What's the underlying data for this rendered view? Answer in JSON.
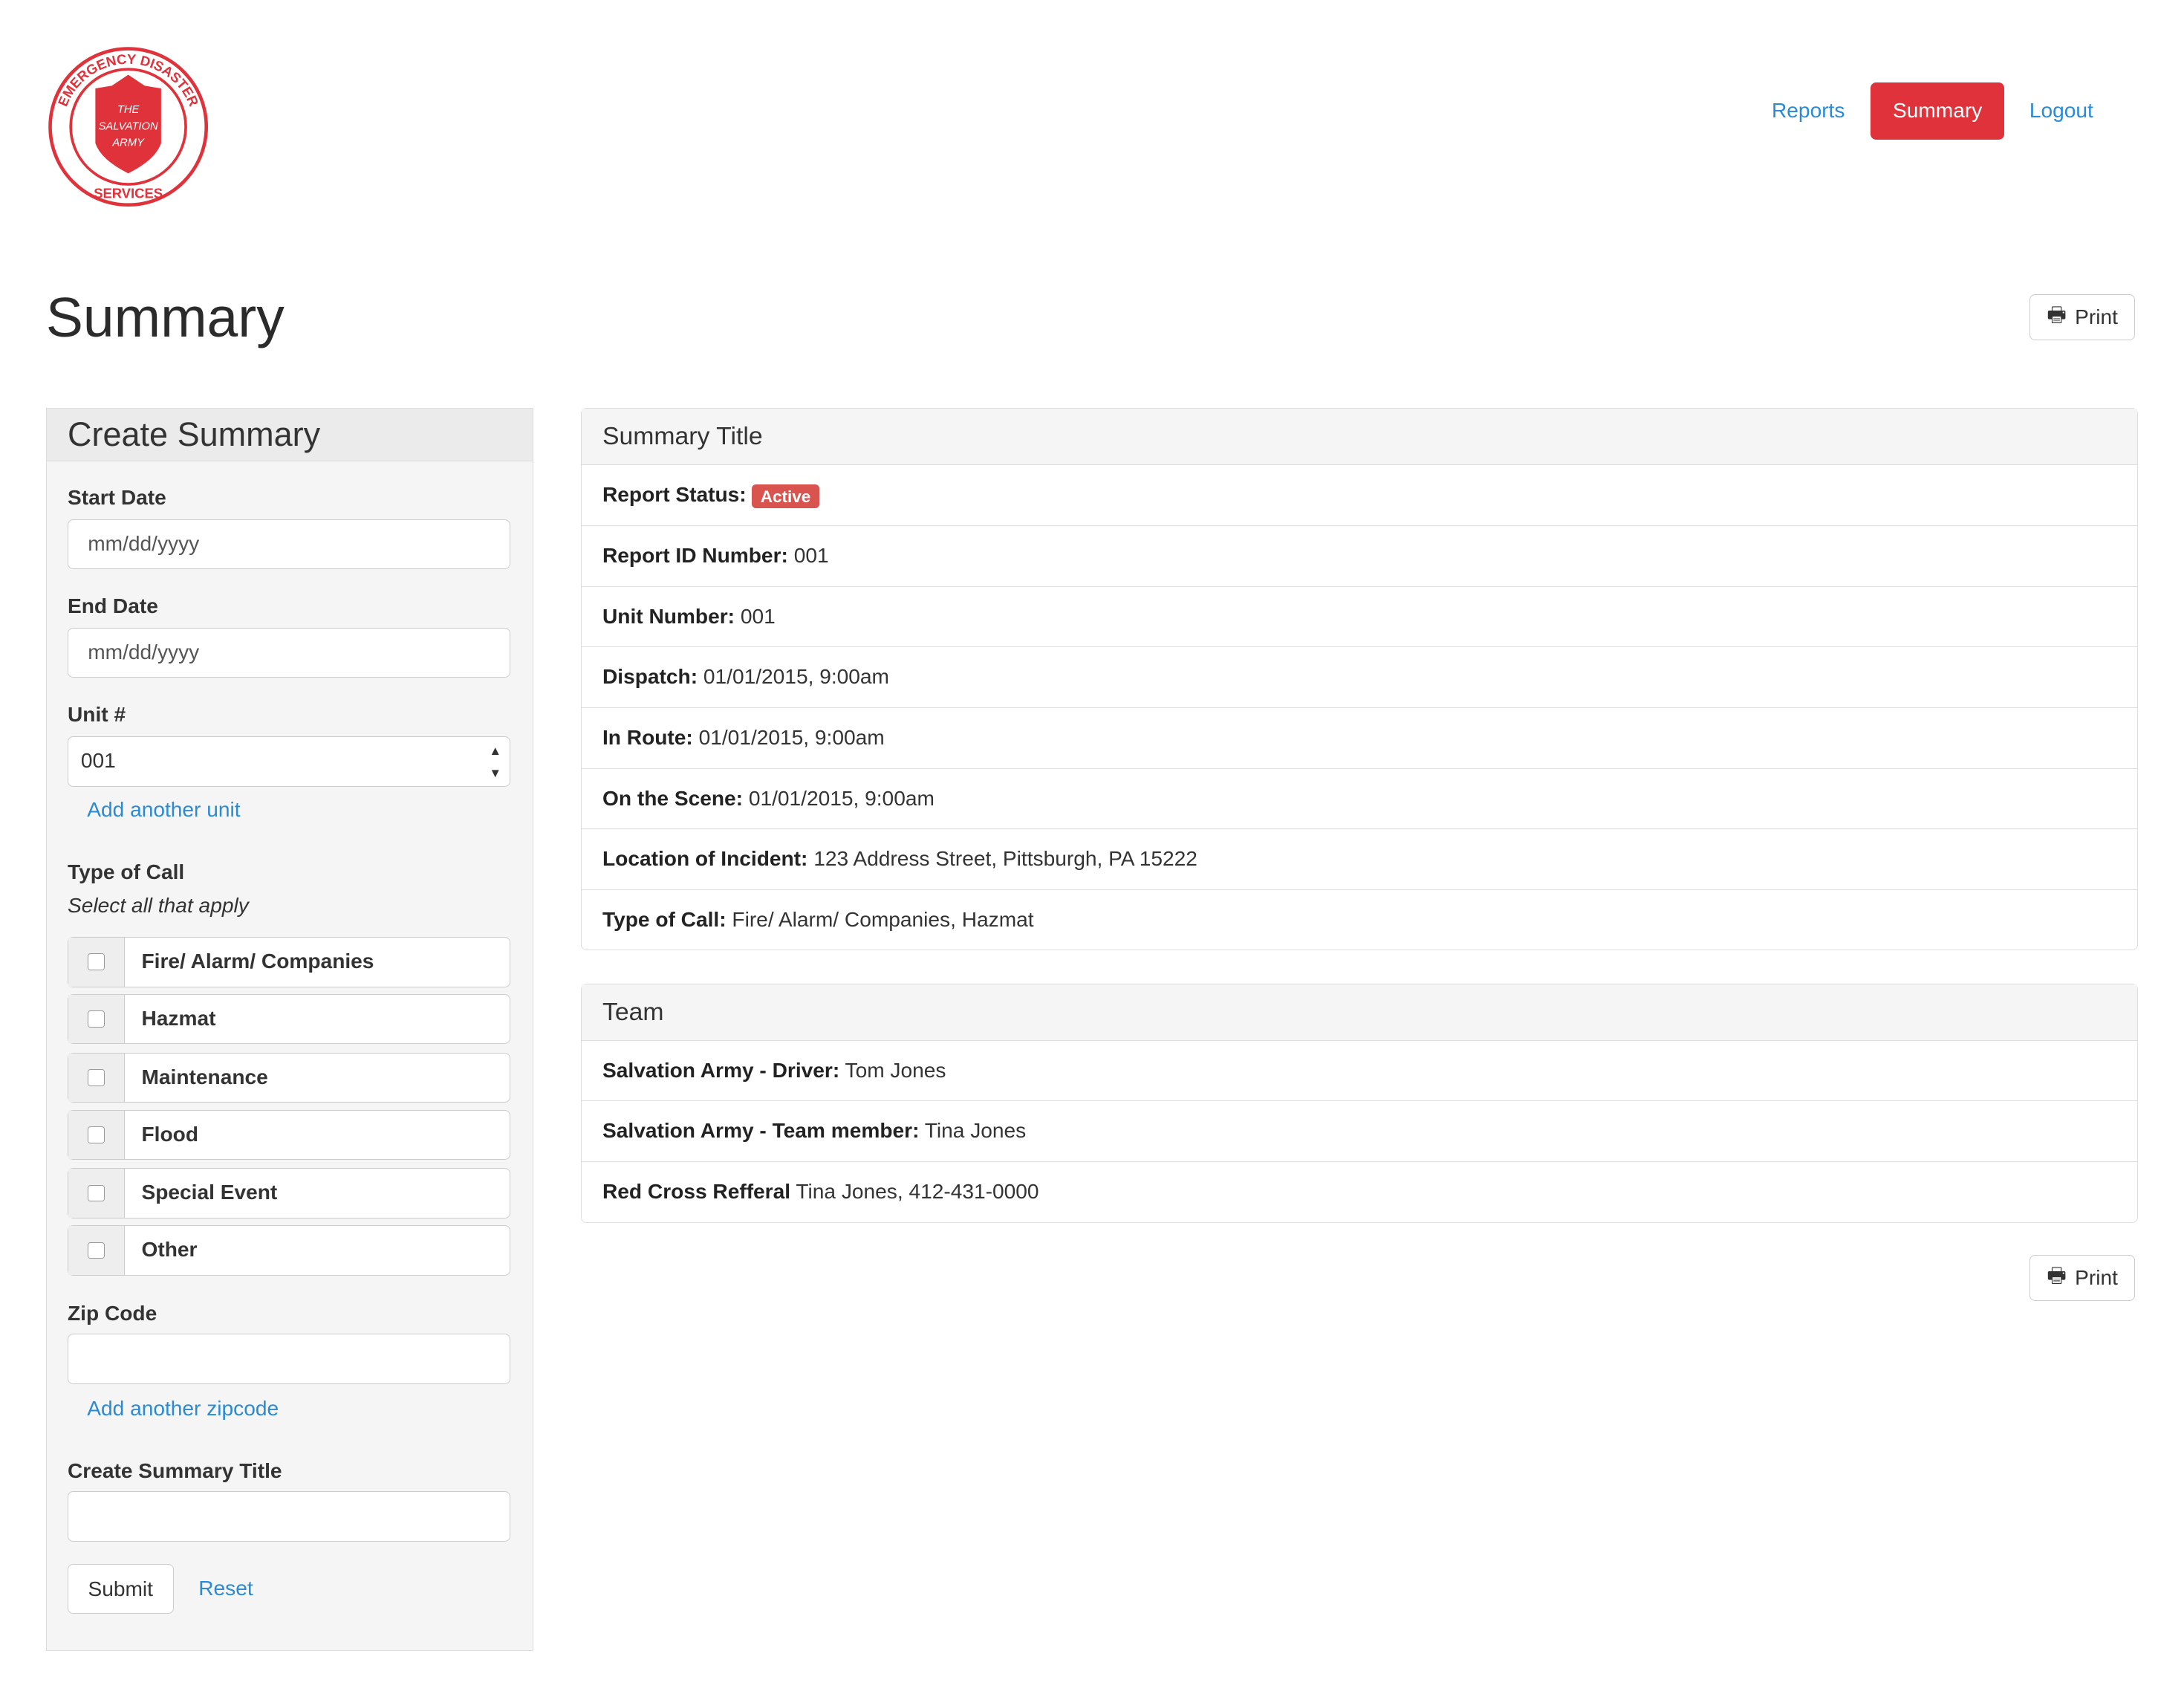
{
  "logo": {
    "text": "EMERGENCY DISASTER SERVICES - THE SALVATION ARMY"
  },
  "nav": {
    "reports": "Reports",
    "summary": "Summary",
    "logout": "Logout"
  },
  "page_title": "Summary",
  "print_label": "Print",
  "form": {
    "title": "Create Summary",
    "start_date_label": "Start Date",
    "start_date_placeholder": "mm/dd/yyyy",
    "end_date_label": "End Date",
    "end_date_placeholder": "mm/dd/yyyy",
    "unit_label": "Unit #",
    "unit_value": "001",
    "add_unit": "Add another unit",
    "type_label": "Type of Call",
    "type_hint": "Select all that apply",
    "types": [
      "Fire/ Alarm/ Companies",
      "Hazmat",
      "Maintenance",
      "Flood",
      "Special Event",
      "Other"
    ],
    "zip_label": "Zip Code",
    "add_zip": "Add another zipcode",
    "summary_title_label": "Create Summary Title",
    "submit": "Submit",
    "reset": "Reset"
  },
  "summary": {
    "title": "Summary Title",
    "status_label": "Report Status:",
    "status": "Active",
    "status_color": "#d9534f",
    "rows": [
      {
        "label": "Report ID Number:",
        "value": "001"
      },
      {
        "label": "Unit Number:",
        "value": "001"
      },
      {
        "label": "Dispatch:",
        "value": "01/01/2015, 9:00am"
      },
      {
        "label": "In Route:",
        "value": "01/01/2015, 9:00am"
      },
      {
        "label": "On the Scene:",
        "value": "01/01/2015, 9:00am"
      },
      {
        "label": "Location of Incident:",
        "value": "123 Address Street, Pittsburgh, PA 15222"
      },
      {
        "label": "Type of Call:",
        "value": "Fire/ Alarm/ Companies, Hazmat"
      }
    ]
  },
  "team": {
    "title": "Team",
    "rows": [
      {
        "label": "Salvation Army - Driver:",
        "value": "Tom Jones"
      },
      {
        "label": "Salvation Army - Team member:",
        "value": "Tina Jones"
      },
      {
        "label": "Red Cross Refferal",
        "value": "Tina Jones, 412-431-0000"
      }
    ]
  }
}
